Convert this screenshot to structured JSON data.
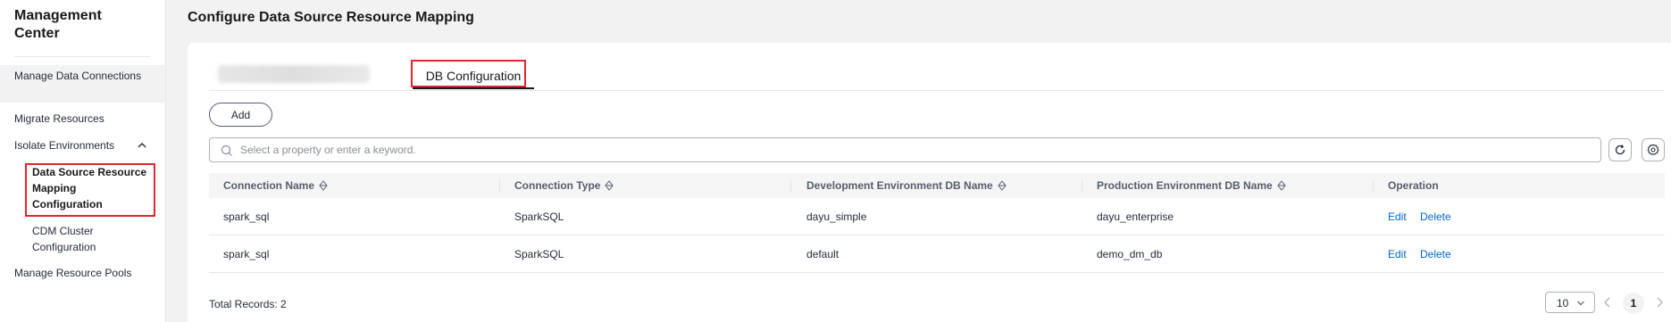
{
  "sidebar": {
    "title": "Management Center",
    "items": [
      {
        "label": "Manage Data Connections"
      },
      {
        "label": "Migrate Resources"
      },
      {
        "label": "Isolate Environments"
      },
      {
        "label": "Data Source Resource Mapping Configuration"
      },
      {
        "label": "CDM Cluster Configuration"
      },
      {
        "label": "Manage Resource Pools"
      }
    ]
  },
  "page": {
    "title": "Configure Data Source Resource Mapping",
    "tabs": [
      {
        "label": ""
      },
      {
        "label": "DB Configuration",
        "active": true
      }
    ]
  },
  "toolbar": {
    "add_label": "Add",
    "search_placeholder": "Select a property or enter a keyword."
  },
  "table": {
    "columns": [
      "Connection Name",
      "Connection Type",
      "Development Environment DB Name",
      "Production Environment DB Name",
      "Operation"
    ],
    "rows": [
      {
        "connection_name": "spark_sql",
        "connection_type": "SparkSQL",
        "dev_db": "dayu_simple",
        "prod_db": "dayu_enterprise",
        "edit": "Edit",
        "delete": "Delete"
      },
      {
        "connection_name": "spark_sql",
        "connection_type": "SparkSQL",
        "dev_db": "default",
        "prod_db": "demo_dm_db",
        "edit": "Edit",
        "delete": "Delete"
      }
    ]
  },
  "footer": {
    "total": "Total Records: 2",
    "page_size": "10",
    "current_page": "1"
  },
  "colors": {
    "accent_link": "#0066cc",
    "highlight_box": "#e0262d"
  },
  "icons": [
    "chevron-up-icon",
    "search-icon",
    "refresh-icon",
    "settings-icon",
    "sort-icon",
    "chevron-down-icon",
    "chevron-left-icon",
    "chevron-right-icon"
  ]
}
